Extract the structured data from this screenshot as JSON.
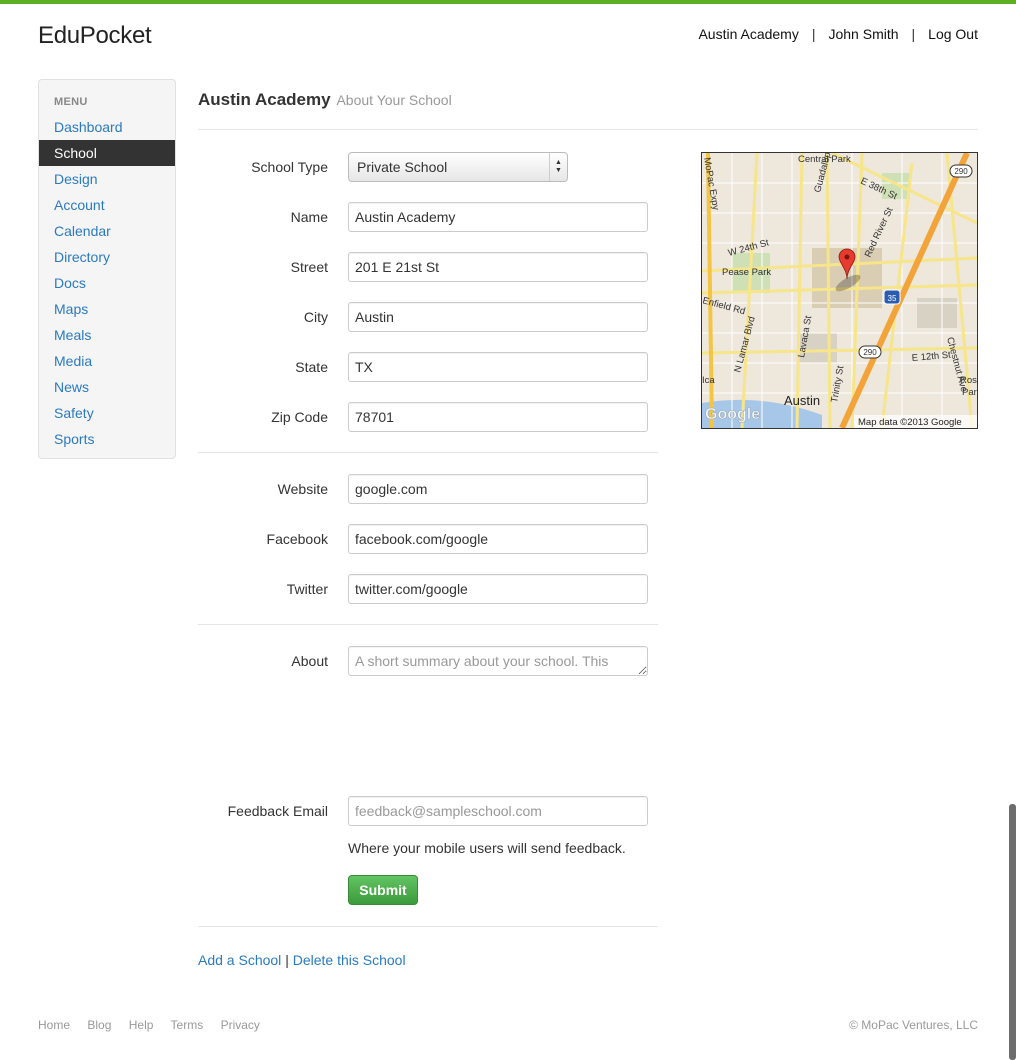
{
  "app": {
    "brand": "EduPocket"
  },
  "topnav": {
    "school": "Austin Academy",
    "user": "John Smith",
    "logout": "Log Out",
    "separator": "|"
  },
  "sidebar": {
    "header": "MENU",
    "items": [
      {
        "label": "Dashboard"
      },
      {
        "label": "School"
      },
      {
        "label": "Design"
      },
      {
        "label": "Account"
      },
      {
        "label": "Calendar"
      },
      {
        "label": "Directory"
      },
      {
        "label": "Docs"
      },
      {
        "label": "Maps"
      },
      {
        "label": "Meals"
      },
      {
        "label": "Media"
      },
      {
        "label": "News"
      },
      {
        "label": "Safety"
      },
      {
        "label": "Sports"
      }
    ],
    "active": "School"
  },
  "page": {
    "title": "Austin Academy",
    "subtitle": "About Your School"
  },
  "form": {
    "school_type": {
      "label": "School Type",
      "value": "Private School"
    },
    "name": {
      "label": "Name",
      "value": "Austin Academy"
    },
    "street": {
      "label": "Street",
      "value": "201 E 21st St"
    },
    "city": {
      "label": "City",
      "value": "Austin"
    },
    "state": {
      "label": "State",
      "value": "TX"
    },
    "zip": {
      "label": "Zip Code",
      "value": "78701"
    },
    "website": {
      "label": "Website",
      "value": "google.com"
    },
    "facebook": {
      "label": "Facebook",
      "value": "facebook.com/google"
    },
    "twitter": {
      "label": "Twitter",
      "value": "twitter.com/google"
    },
    "about": {
      "label": "About",
      "placeholder": "A short summary about your school. This information will appear in the 'About' section of your mobile app."
    },
    "feedback": {
      "label": "Feedback Email",
      "placeholder": "feedback@sampleschool.com",
      "help": "Where your mobile users will send feedback."
    },
    "submit_label": "Submit"
  },
  "links": {
    "add": "Add a School",
    "delete": "Delete this School",
    "separator": "|"
  },
  "map": {
    "attribution": "Map data ©2013 Google",
    "logo": "Google",
    "labels": {
      "austin": "Austin",
      "pease": "Pease Park",
      "central": "Central Park",
      "w24": "W 24th St",
      "e38": "E 38th St",
      "e12": "E 12th St",
      "red_river": "Red River St",
      "chestnut": "Chestnut Ave",
      "lamar": "N Lamar Blvd",
      "guadalupe": "Guadalupe St",
      "lavaca": "Lavaca St",
      "trinity": "Trinity St",
      "enfield": "Enfield Rd",
      "mopac": "MoPac Expy",
      "rosew": "Rosew",
      "i35": "35",
      "us290": "290"
    }
  },
  "footer": {
    "links": [
      "Home",
      "Blog",
      "Help",
      "Terms",
      "Privacy"
    ],
    "copyright": "© MoPac Ventures, LLC"
  },
  "colors": {
    "accent": "#5fae24",
    "link": "#2a7ac2",
    "active_nav": "#333333",
    "submit": "#4cae4c"
  }
}
